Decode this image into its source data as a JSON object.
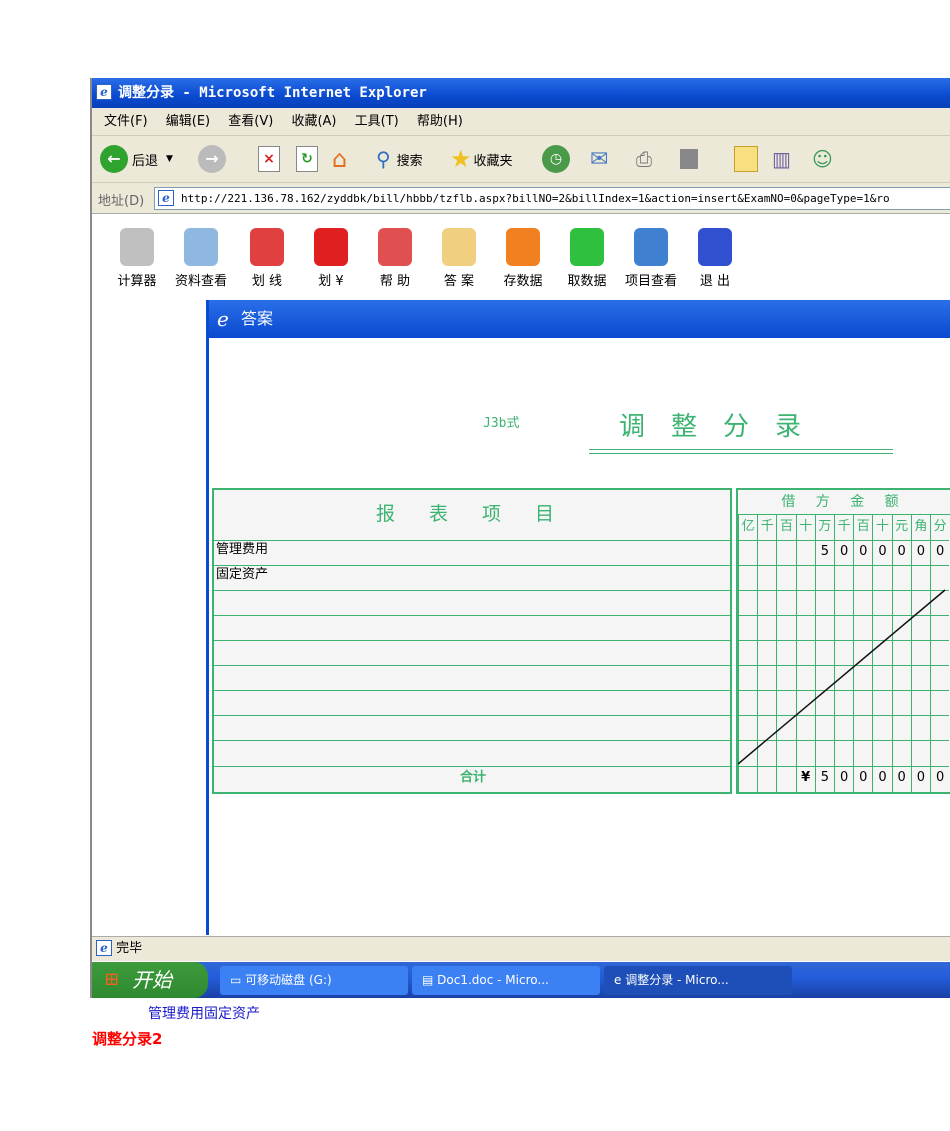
{
  "window": {
    "title": "调整分录 - Microsoft Internet Explorer"
  },
  "menu": [
    "文件(F)",
    "编辑(E)",
    "查看(V)",
    "收藏(A)",
    "工具(T)",
    "帮助(H)"
  ],
  "toolbar": {
    "back": "后退",
    "search": "搜索",
    "favorites": "收藏夹"
  },
  "address": {
    "label": "地址(D)",
    "url": "http://221.136.78.162/zyddbk/bill/hbbb/tzflb.aspx?billNO=2&billIndex=1&action=insert&ExamNO=0&pageType=1&ro"
  },
  "app_tools": [
    {
      "label": "计算器",
      "color": "#c0c0c0"
    },
    {
      "label": "资料查看",
      "color": "#8fb8e0"
    },
    {
      "label": "划 线",
      "color": "#e04040"
    },
    {
      "label": "划 ¥",
      "color": "#e02020"
    },
    {
      "label": "帮 助",
      "color": "#e05050"
    },
    {
      "label": "答 案",
      "color": "#f0d080"
    },
    {
      "label": "存数据",
      "color": "#f08020"
    },
    {
      "label": "取数据",
      "color": "#30c040"
    },
    {
      "label": "项目查看",
      "color": "#4080d0"
    },
    {
      "label": "退 出",
      "color": "#3050d0"
    }
  ],
  "dialog": {
    "title": "答案",
    "code": "J3b式",
    "voucher_title": "调整分录",
    "items_header": "报 表 项 目",
    "amount_header": "借 方 金 额",
    "units": [
      "亿",
      "千",
      "百",
      "十",
      "万",
      "千",
      "百",
      "十",
      "元",
      "角",
      "分"
    ],
    "rows": [
      {
        "item": "管理费用",
        "digits": [
          "",
          "",
          "",
          "",
          "5",
          "0",
          "0",
          "0",
          "0",
          "0",
          "0"
        ]
      },
      {
        "item": "固定资产",
        "digits": [
          "",
          "",
          "",
          "",
          "",
          "",
          "",
          "",
          "",
          "",
          ""
        ]
      }
    ],
    "total_label": "合计",
    "total_digits": [
      "",
      "",
      "",
      "¥",
      "5",
      "0",
      "0",
      "0",
      "0",
      "0",
      "0"
    ]
  },
  "status": "完毕",
  "taskbar": {
    "start": "开始",
    "tasks": [
      "可移动磁盘 (G:)",
      "Doc1.doc - Micro...",
      "调整分录 - Micro..."
    ]
  },
  "doc": {
    "line1": "管理费用固定资产",
    "line2": "调整分录2"
  },
  "colors": {
    "grid": "#3cb371",
    "titlebar": "#0a4ad0",
    "heading": "#ff0000",
    "body_text": "#1a1acc"
  }
}
